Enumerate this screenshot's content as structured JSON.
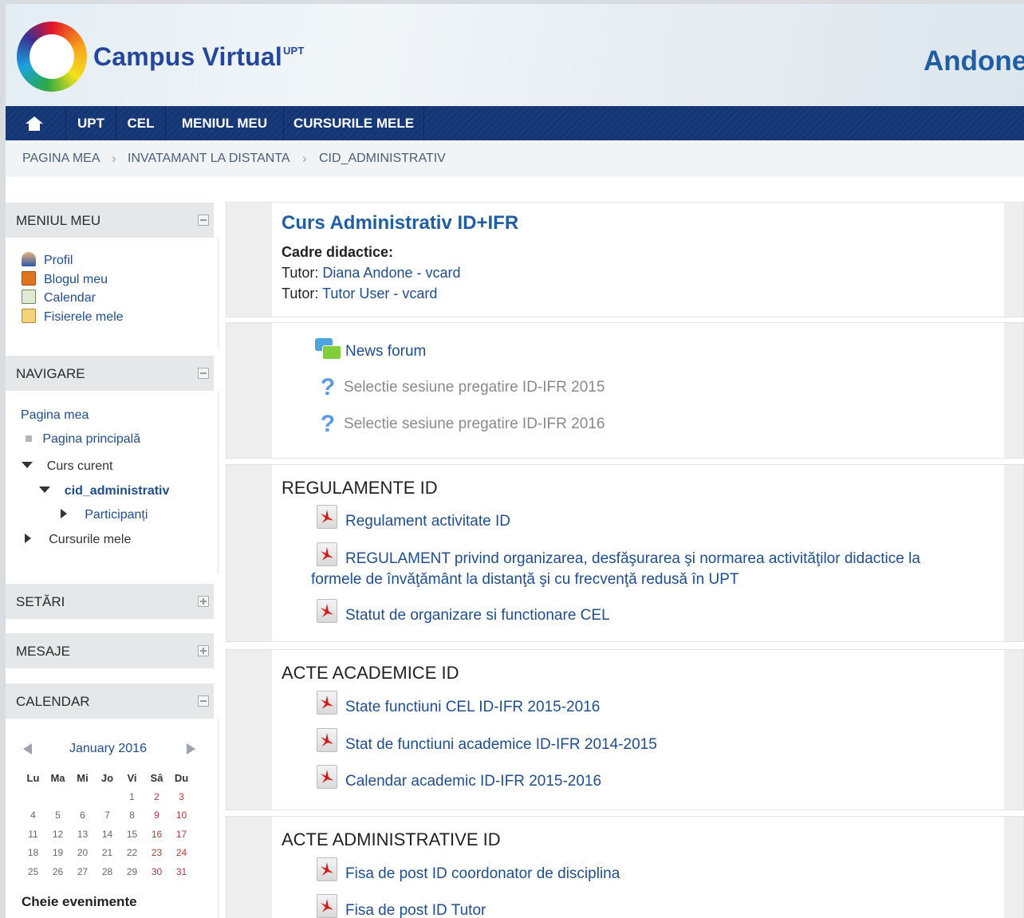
{
  "header": {
    "logo_text": "Campus Virtual",
    "logo_sup": "UPT",
    "user_name": "Andone"
  },
  "navbar": {
    "items": [
      "UPT",
      "CEL",
      "MENIUL MEU",
      "CURSURILE MELE"
    ]
  },
  "breadcrumb": [
    "PAGINA MEA",
    "INVATAMANT LA DISTANTA",
    "CID_ADMINISTRATIV"
  ],
  "blocks": {
    "meniul_meu": {
      "title": "MENIUL MEU",
      "items": [
        "Profil",
        "Blogul meu",
        "Calendar",
        "Fisierele mele"
      ]
    },
    "navigare": {
      "title": "NAVIGARE",
      "pagina_mea": "Pagina mea",
      "pagina_principala": "Pagina principală",
      "curs_curent": "Curs curent",
      "course": "cid_administrativ",
      "participanti": "Participanți",
      "cursurile_mele": "Cursurile mele"
    },
    "setari": {
      "title": "SETĂRI"
    },
    "mesaje": {
      "title": "MESAJE"
    },
    "calendar": {
      "title": "CALENDAR",
      "month": "January 2016",
      "days": [
        "Lu",
        "Ma",
        "Mi",
        "Jo",
        "Vi",
        "Sâ",
        "Du"
      ],
      "weeks": [
        [
          "",
          "",
          "",
          "",
          "1",
          "2",
          "3"
        ],
        [
          "4",
          "5",
          "6",
          "7",
          "8",
          "9",
          "10"
        ],
        [
          "11",
          "12",
          "13",
          "14",
          "15",
          "16",
          "17"
        ],
        [
          "18",
          "19",
          "20",
          "21",
          "22",
          "23",
          "24"
        ],
        [
          "25",
          "26",
          "27",
          "28",
          "29",
          "30",
          "31"
        ]
      ],
      "key_label": "Cheie evenimente"
    }
  },
  "course": {
    "title": "Curs Administrativ ID+IFR",
    "teachers_label": "Cadre didactice:",
    "tutors": [
      {
        "role": "Tutor:",
        "name": "Diana Andone",
        "vcard": "vcard"
      },
      {
        "role": "Tutor:",
        "name": "Tutor User",
        "vcard": "vcard"
      }
    ]
  },
  "general": {
    "news": "News forum",
    "quiz1": "Selectie sesiune pregatire ID-IFR 2015",
    "quiz2": "Selectie sesiune pregatire ID-IFR 2016"
  },
  "sections": [
    {
      "title": "REGULAMENTE ID",
      "items": [
        "Regulament activitate ID",
        "REGULAMENT privind organizarea, desfăşurarea şi normarea activităţilor didactice la",
        "formele de învăţământ la distanţă şi cu frecvenţă redusă în UPT",
        "Statut de organizare si functionare CEL"
      ]
    },
    {
      "title": "ACTE ACADEMICE ID",
      "items": [
        "State functiuni CEL ID-IFR 2015-2016",
        "Stat de functiuni academice ID-IFR 2014-2015",
        "Calendar academic ID-IFR 2015-2016"
      ]
    },
    {
      "title": "ACTE ADMINISTRATIVE ID",
      "items": [
        "Fisa de post ID coordonator de disciplina",
        "Fisa de post ID Tutor"
      ]
    }
  ]
}
